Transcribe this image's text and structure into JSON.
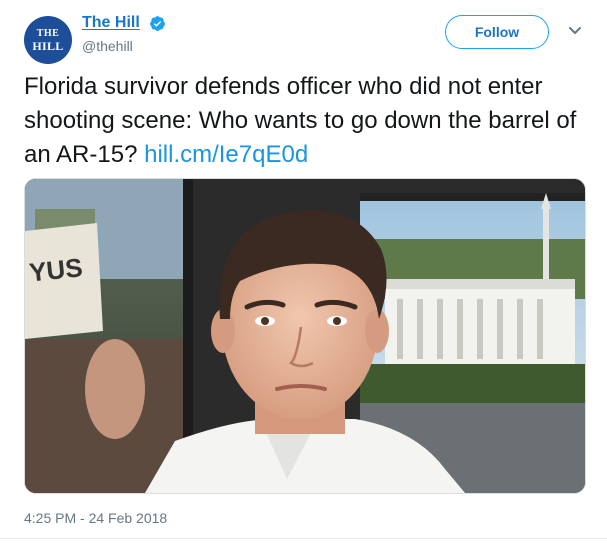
{
  "account": {
    "avatar_line1": "THE",
    "avatar_line2": "HILL",
    "name": "The Hill",
    "handle": "@thehill"
  },
  "follow_label": "Follow",
  "tweet": {
    "text": "Florida survivor defends officer who did not enter shooting scene: Who wants to go down the barrel of an AR-15?",
    "link": "hill.cm/Ie7qE0d"
  },
  "media": {
    "sign_text": "YUS"
  },
  "timestamp": "4:25 PM - 24 Feb 2018",
  "colors": {
    "brand_blue": "#1da1f2",
    "link_blue": "#1b95e0",
    "avatar_bg": "#1c4e9a"
  },
  "icons": [
    "verified-badge-icon",
    "chevron-down-icon"
  ]
}
